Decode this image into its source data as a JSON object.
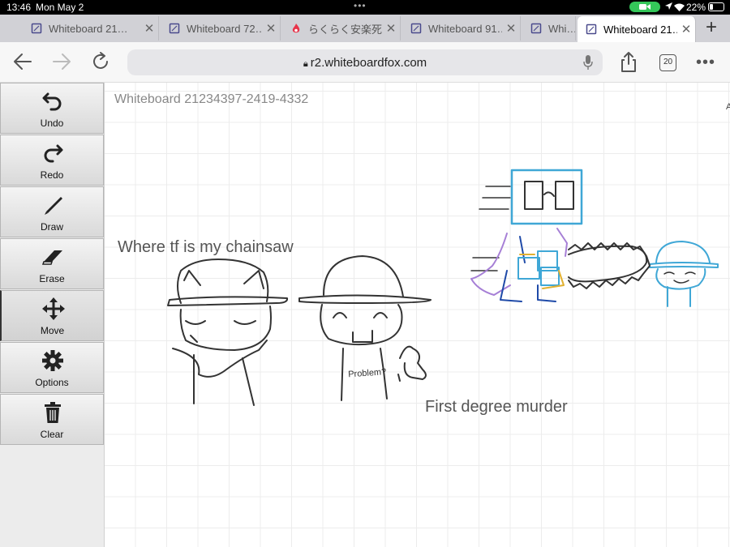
{
  "status": {
    "time": "13:46",
    "date": "Mon May 2",
    "battery": "22%",
    "battery_level": 0.22
  },
  "tabs": [
    {
      "label": "Whiteboard 21…",
      "icon": "whiteboard-page-icon",
      "active": false
    },
    {
      "label": "Whiteboard 72…",
      "icon": "whiteboard-page-icon",
      "active": false
    },
    {
      "label": "らくらく安楽死…",
      "icon": "flame-icon",
      "active": false
    },
    {
      "label": "Whiteboard 91…",
      "icon": "whiteboard-page-icon",
      "active": false
    },
    {
      "label": "Whi…",
      "icon": "whiteboard-page-icon",
      "active": false
    },
    {
      "label": "Whiteboard 21…",
      "icon": "whiteboard-page-icon",
      "active": true
    }
  ],
  "address": {
    "url": "r2.whiteboardfox.com",
    "tab_count": "20"
  },
  "toolbar": {
    "undo": "Undo",
    "redo": "Redo",
    "draw": "Draw",
    "erase": "Erase",
    "move": "Move",
    "options": "Options",
    "clear": "Clear",
    "selected_tool": "Move"
  },
  "board": {
    "title": "Whiteboard 21234397-2419-4332",
    "caption_1": "Where tf is my chainsaw",
    "caption_2": "First degree murder",
    "shirt_text": "Problem?",
    "edge_mark": "A"
  }
}
